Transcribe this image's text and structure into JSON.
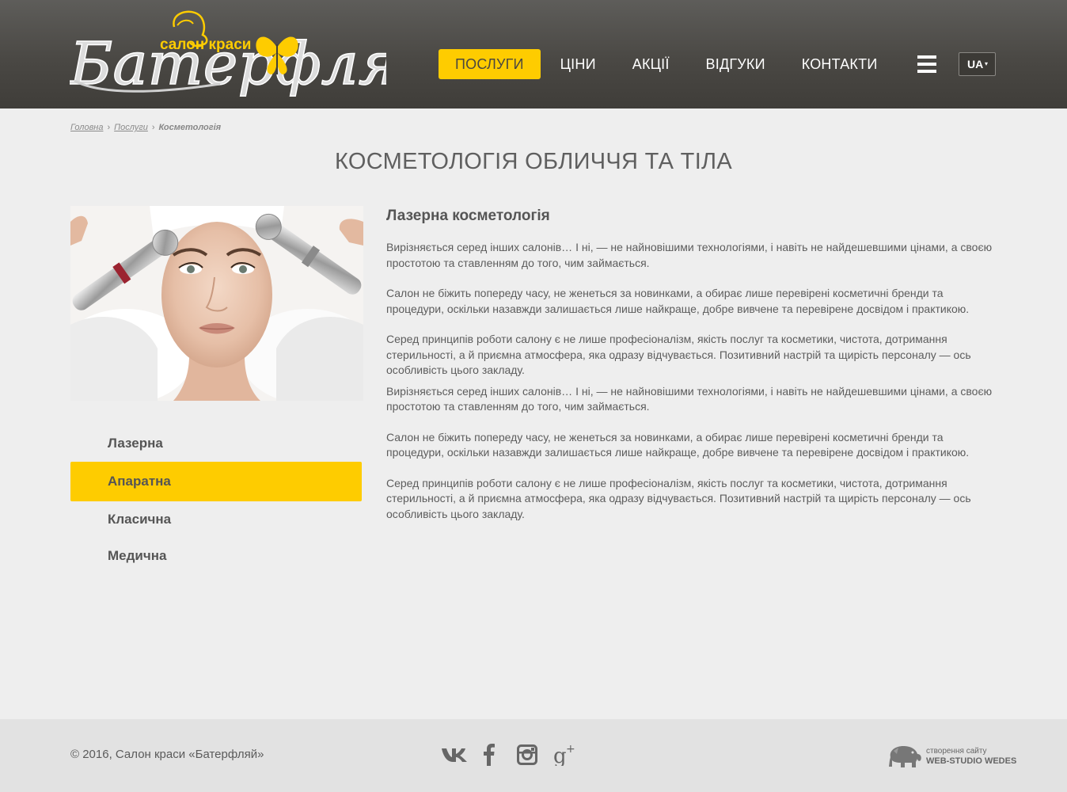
{
  "header": {
    "logo": {
      "subtitle": "салон краси",
      "name": "Батерфляй"
    },
    "nav": [
      {
        "label": "ПОСЛУГИ",
        "active": true
      },
      {
        "label": "ЦІНИ",
        "active": false
      },
      {
        "label": "АКЦІЇ",
        "active": false
      },
      {
        "label": "ВІДГУКИ",
        "active": false
      },
      {
        "label": "КОНТАКТИ",
        "active": false
      }
    ],
    "language": "UA",
    "accent_color": "#fecc00"
  },
  "breadcrumb": {
    "items": [
      "Головна",
      "Послуги"
    ],
    "current": "Косметологія"
  },
  "page_title": "КОСМЕТОЛОГІЯ ОБЛИЧЧЯ ТА ТІЛА",
  "side_menu": {
    "items": [
      {
        "label": "Лазерна",
        "active": false
      },
      {
        "label": "Апаратна",
        "active": true
      },
      {
        "label": "Класична",
        "active": false
      },
      {
        "label": "Медична",
        "active": false
      }
    ]
  },
  "content": {
    "heading": "Лазерна косметологія",
    "paragraphs": [
      "Вирізняється серед інших салонів… І ні, — не найновішими технологіями, і навіть не найдешевшими цінами, а своєю простотою та ставленням до того, чим займається.",
      "Салон не біжить попереду часу, не женеться за новинками, а обирає лише перевірені косметичні бренди та процедури, оскільки назавжди залишається лише найкраще, добре вивчене та перевірене досвідом і практикою.",
      "Серед принципів роботи салону є не лише професіоналізм, якість послуг та косметики, чистота, дотримання стерильності, а й приємна атмосфера, яка одразу відчувається. Позитивний настрій та щирість персоналу — ось особливість цього закладу.",
      "Вирізняється серед інших салонів… І ні, — не найновішими технологіями, і навіть не найдешевшими цінами, а своєю простотою та ставленням до того, чим займається.",
      "Салон не біжить попереду часу, не женеться за новинками, а обирає лише перевірені косметичні бренди та процедури, оскільки назавжди залишається лише найкраще, добре вивчене та перевірене досвідом і практикою.",
      "Серед принципів роботи салону є не лише професіоналізм, якість послуг та косметики, чистота, дотримання стерильності, а й приємна атмосфера, яка одразу відчувається. Позитивний настрій та щирість персоналу — ось особливість цього закладу."
    ]
  },
  "footer": {
    "copyright": "© 2016, Салон краси «Батерфляй»",
    "social_icons": [
      "vk-icon",
      "facebook-icon",
      "instagram-icon",
      "google-plus-icon"
    ],
    "studio_line1": "створення сайту",
    "studio_line2": "WEB-STUDIO WEDES"
  }
}
